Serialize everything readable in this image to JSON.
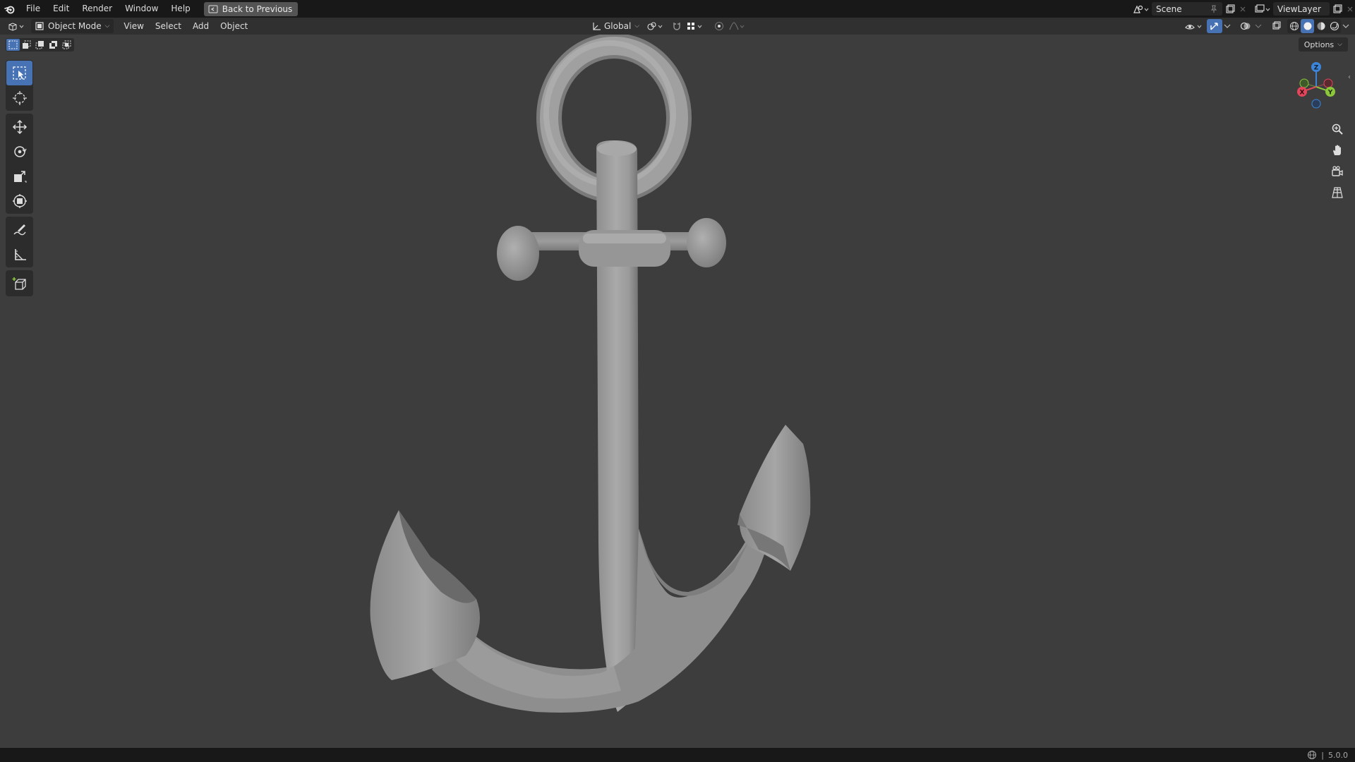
{
  "topbar": {
    "menus": [
      "File",
      "Edit",
      "Render",
      "Window",
      "Help"
    ],
    "back_label": "Back to Previous",
    "scene_name": "Scene",
    "view_layer": "ViewLayer"
  },
  "header": {
    "mode_label": "Object Mode",
    "menus": [
      "View",
      "Select",
      "Add",
      "Object"
    ],
    "orientation_label": "Global",
    "options_label": "Options"
  },
  "viewport": {
    "object_icon": "anchor-mesh",
    "gizmo_axes": [
      "Z",
      "X",
      "Y"
    ]
  },
  "toolbar": {
    "tools": [
      "select-box",
      "cursor",
      "move",
      "rotate",
      "scale",
      "transform",
      "annotate",
      "measure",
      "add-cube"
    ],
    "active_tool": "select-box"
  },
  "statusbar": {
    "version": "5.0.0"
  },
  "colors": {
    "accent": "#4772b3",
    "viewport_bg": "#3d3d3d",
    "axis_x": "#e2465a",
    "axis_y": "#8bc63c",
    "axis_z": "#3d85d8"
  }
}
